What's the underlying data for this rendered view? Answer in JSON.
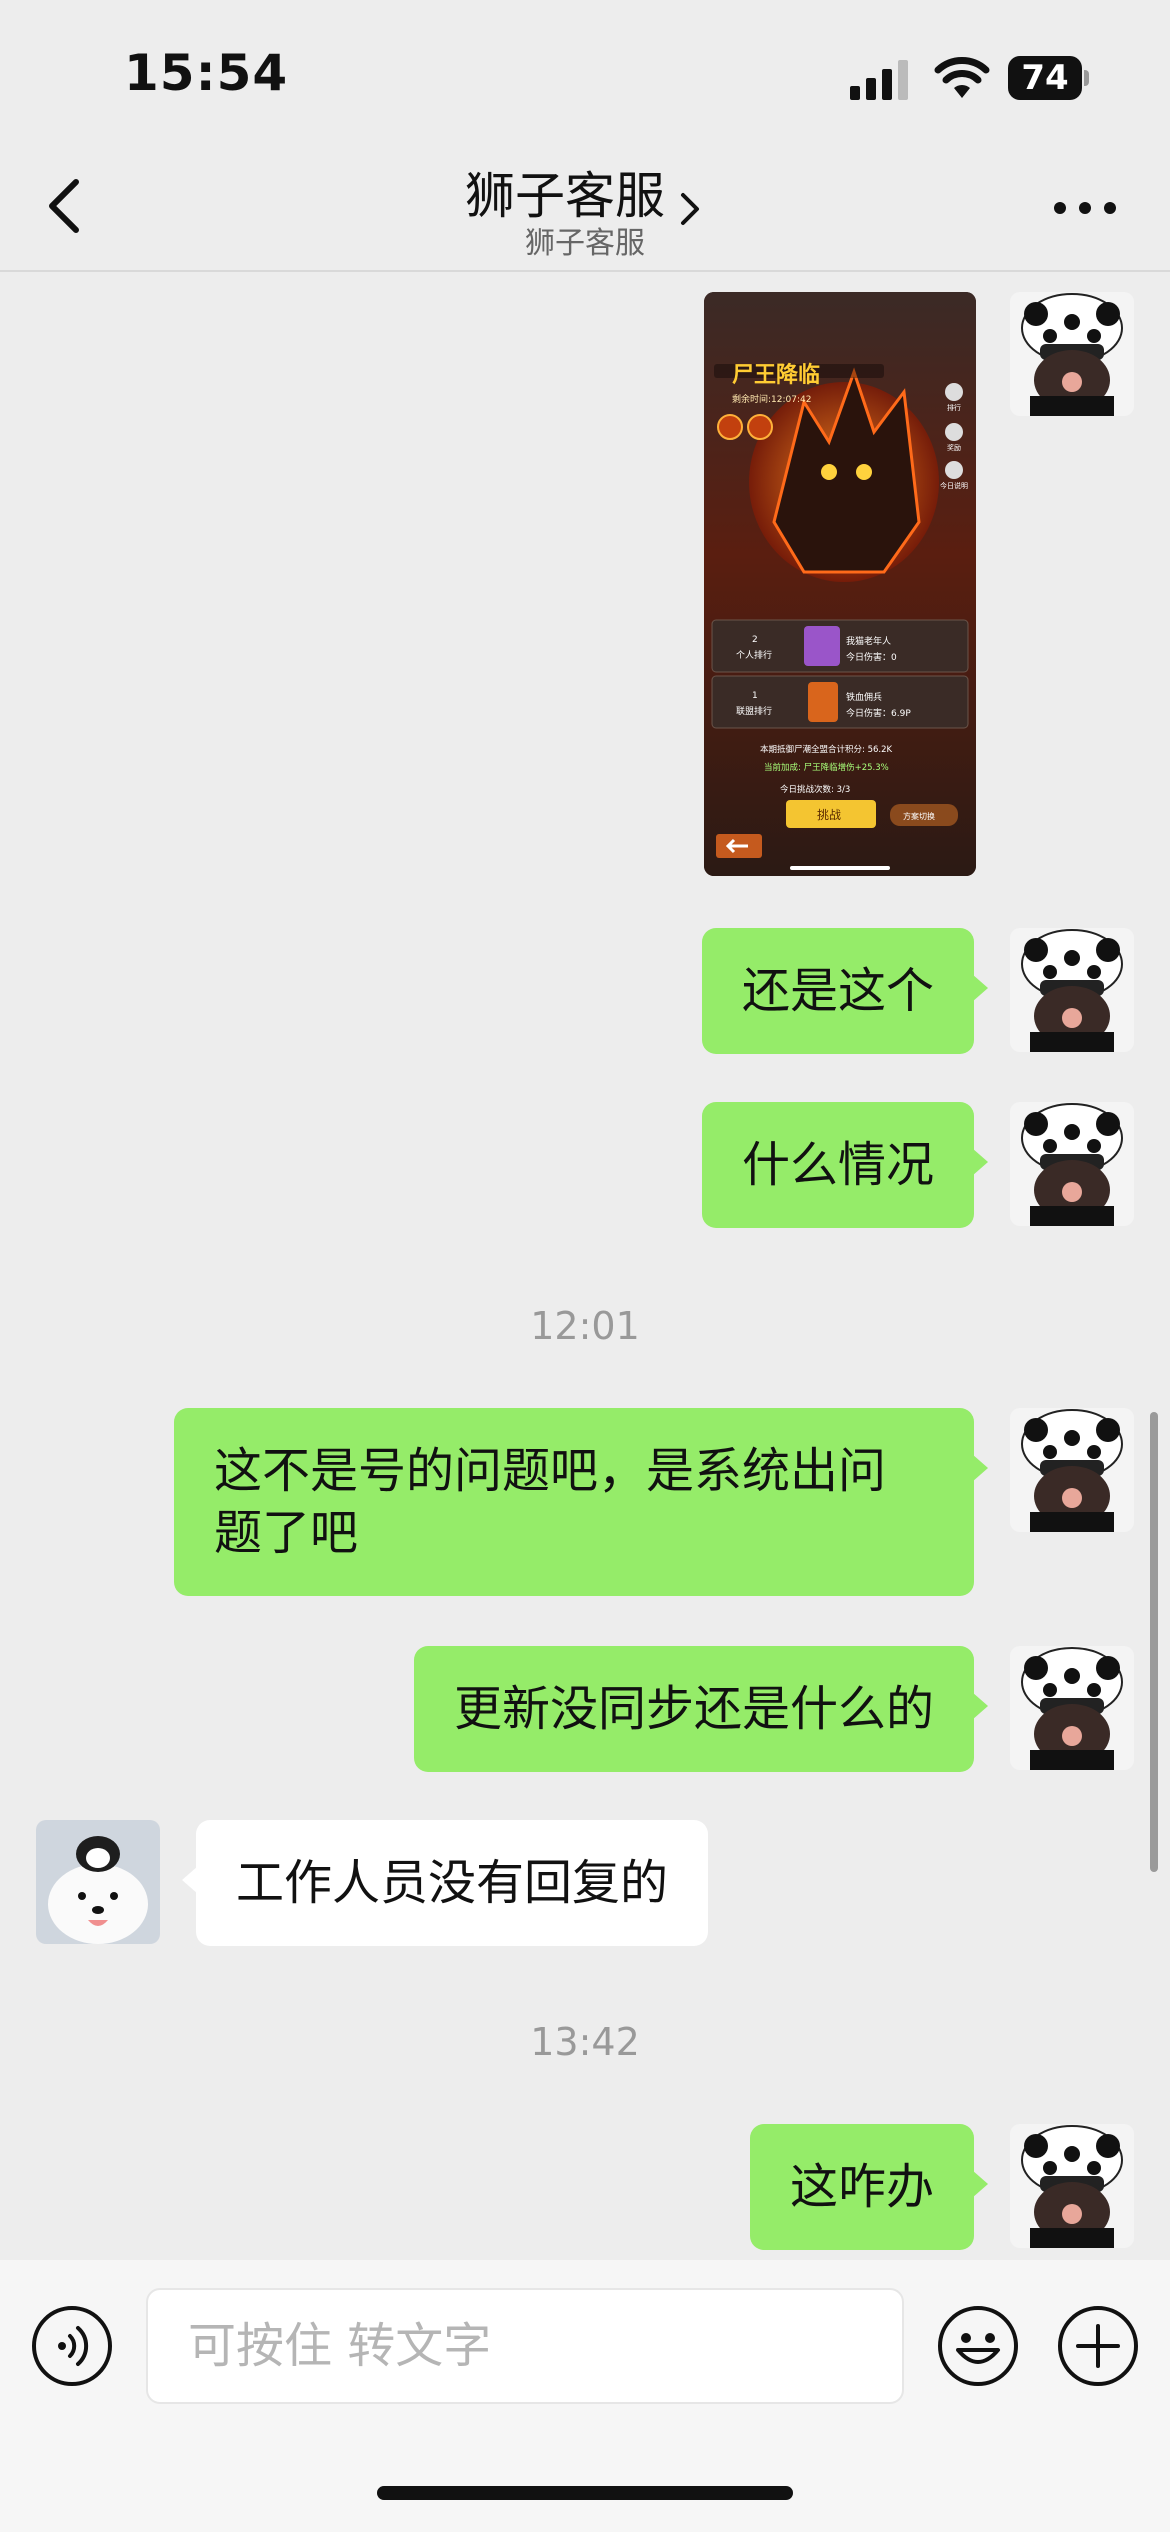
{
  "status_bar": {
    "time": "15:54",
    "battery": "74"
  },
  "header": {
    "title": "狮子客服",
    "subtitle": "狮子客服"
  },
  "game_screenshot": {
    "banner_title": "尸王降临",
    "remaining_time": "剩余时间:12:07:42",
    "personal_rank_number": "2",
    "personal_rank_label": "个人排行",
    "personal_player": "我猫老年人",
    "personal_damage": "今日伤害：0",
    "alliance_rank_number": "1",
    "alliance_rank_label": "联盟排行",
    "alliance_name": "铁血佣兵",
    "alliance_damage": "今日伤害：6.9P",
    "total_score_line": "本期抵御尸潮全盟合计积分: 56.2K",
    "bonus_line": "当前加成: 尸王降临增伤+25.3%",
    "attempts_line": "今日挑战次数: 3/3",
    "challenge_button": "挑战",
    "plan_switch": "方案切换",
    "side_icons": [
      "排行",
      "奖励",
      "今日说明"
    ]
  },
  "messages": [
    {
      "type": "sent",
      "text": "还是这个"
    },
    {
      "type": "sent",
      "text": "什么情况"
    },
    {
      "type": "time",
      "text": "12:01"
    },
    {
      "type": "sent",
      "line1": "这不是号的问题吧，是系统出问",
      "line2": "题了吧"
    },
    {
      "type": "sent",
      "text": "更新没同步还是什么的"
    },
    {
      "type": "received",
      "text": "工作人员没有回复的"
    },
    {
      "type": "time",
      "text": "13:42"
    },
    {
      "type": "sent",
      "text": "这咋办"
    }
  ],
  "input_bar": {
    "placeholder": "可按住 转文字"
  },
  "colors": {
    "sent_bubble": "#95ec69",
    "received_bubble": "#ffffff",
    "background": "#ededed"
  }
}
